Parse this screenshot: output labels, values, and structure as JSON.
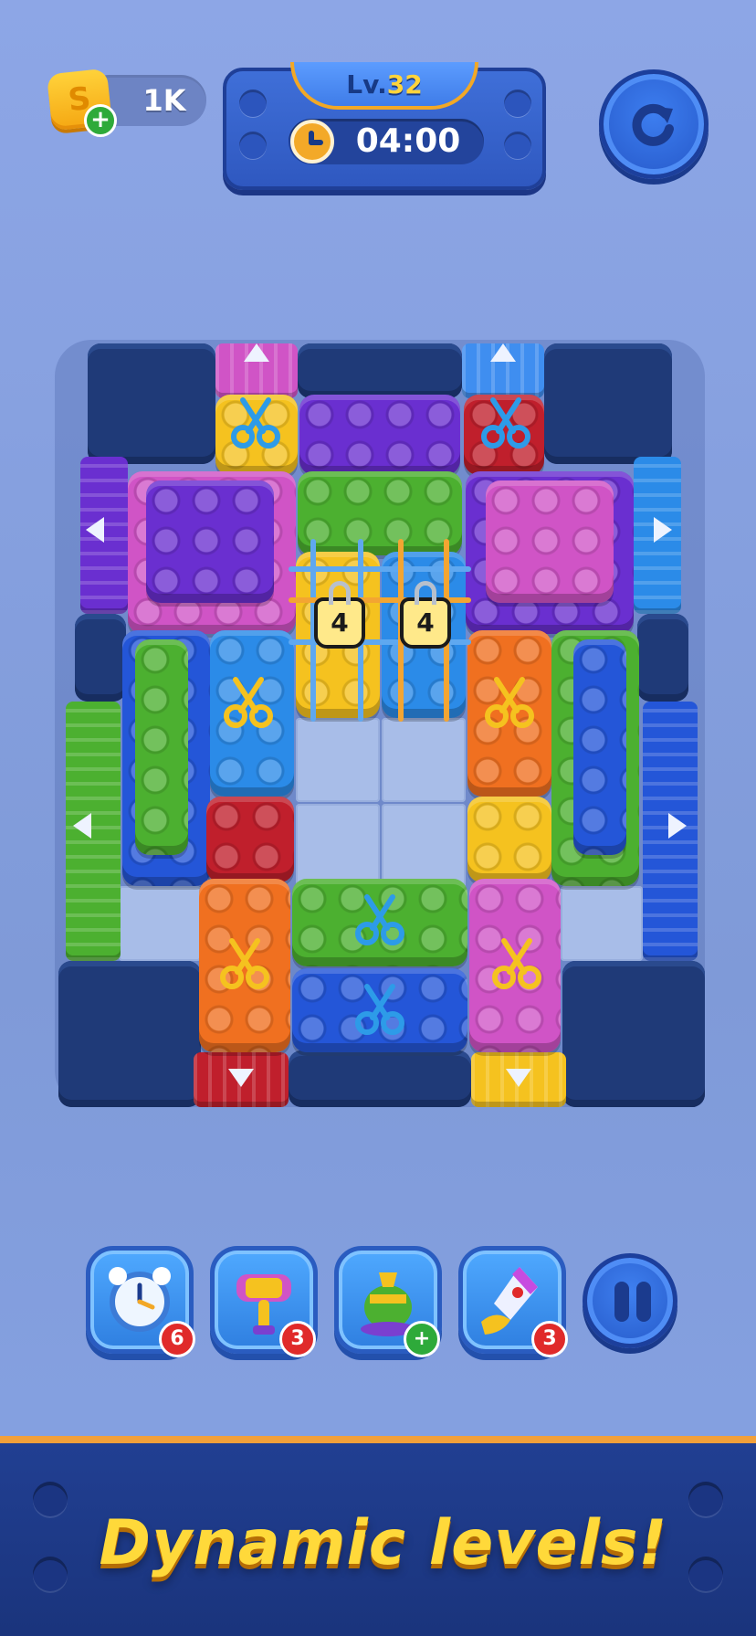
{
  "hud": {
    "coins": "1K",
    "coin_symbol": "S",
    "plus": "+",
    "level_prefix": "Lv.",
    "level_number": "32",
    "timer": "04:00"
  },
  "board": {
    "lock_counts": [
      "4",
      "4"
    ],
    "exit_arrows": [
      "up-pink",
      "up-blue",
      "left-purple",
      "right-blue",
      "left-green",
      "right-blue",
      "down-red",
      "down-yellow"
    ]
  },
  "boosters": [
    {
      "name": "freeze-clock",
      "count": "6"
    },
    {
      "name": "hammer",
      "count": "3"
    },
    {
      "name": "vacuum",
      "count": "+"
    },
    {
      "name": "rocket",
      "count": "3"
    }
  ],
  "banner": {
    "text": "Dynamic levels!"
  },
  "colors": {
    "background": "#8da6e6",
    "wall": "#1f3a78",
    "pink": "#d054c6",
    "yellow": "#f5c21f",
    "purple": "#6a2fd0",
    "red": "#c01f2c",
    "green": "#4cb030",
    "blue": "#2b76e6",
    "orange": "#f07020",
    "banner_text": "#ffd93a"
  }
}
